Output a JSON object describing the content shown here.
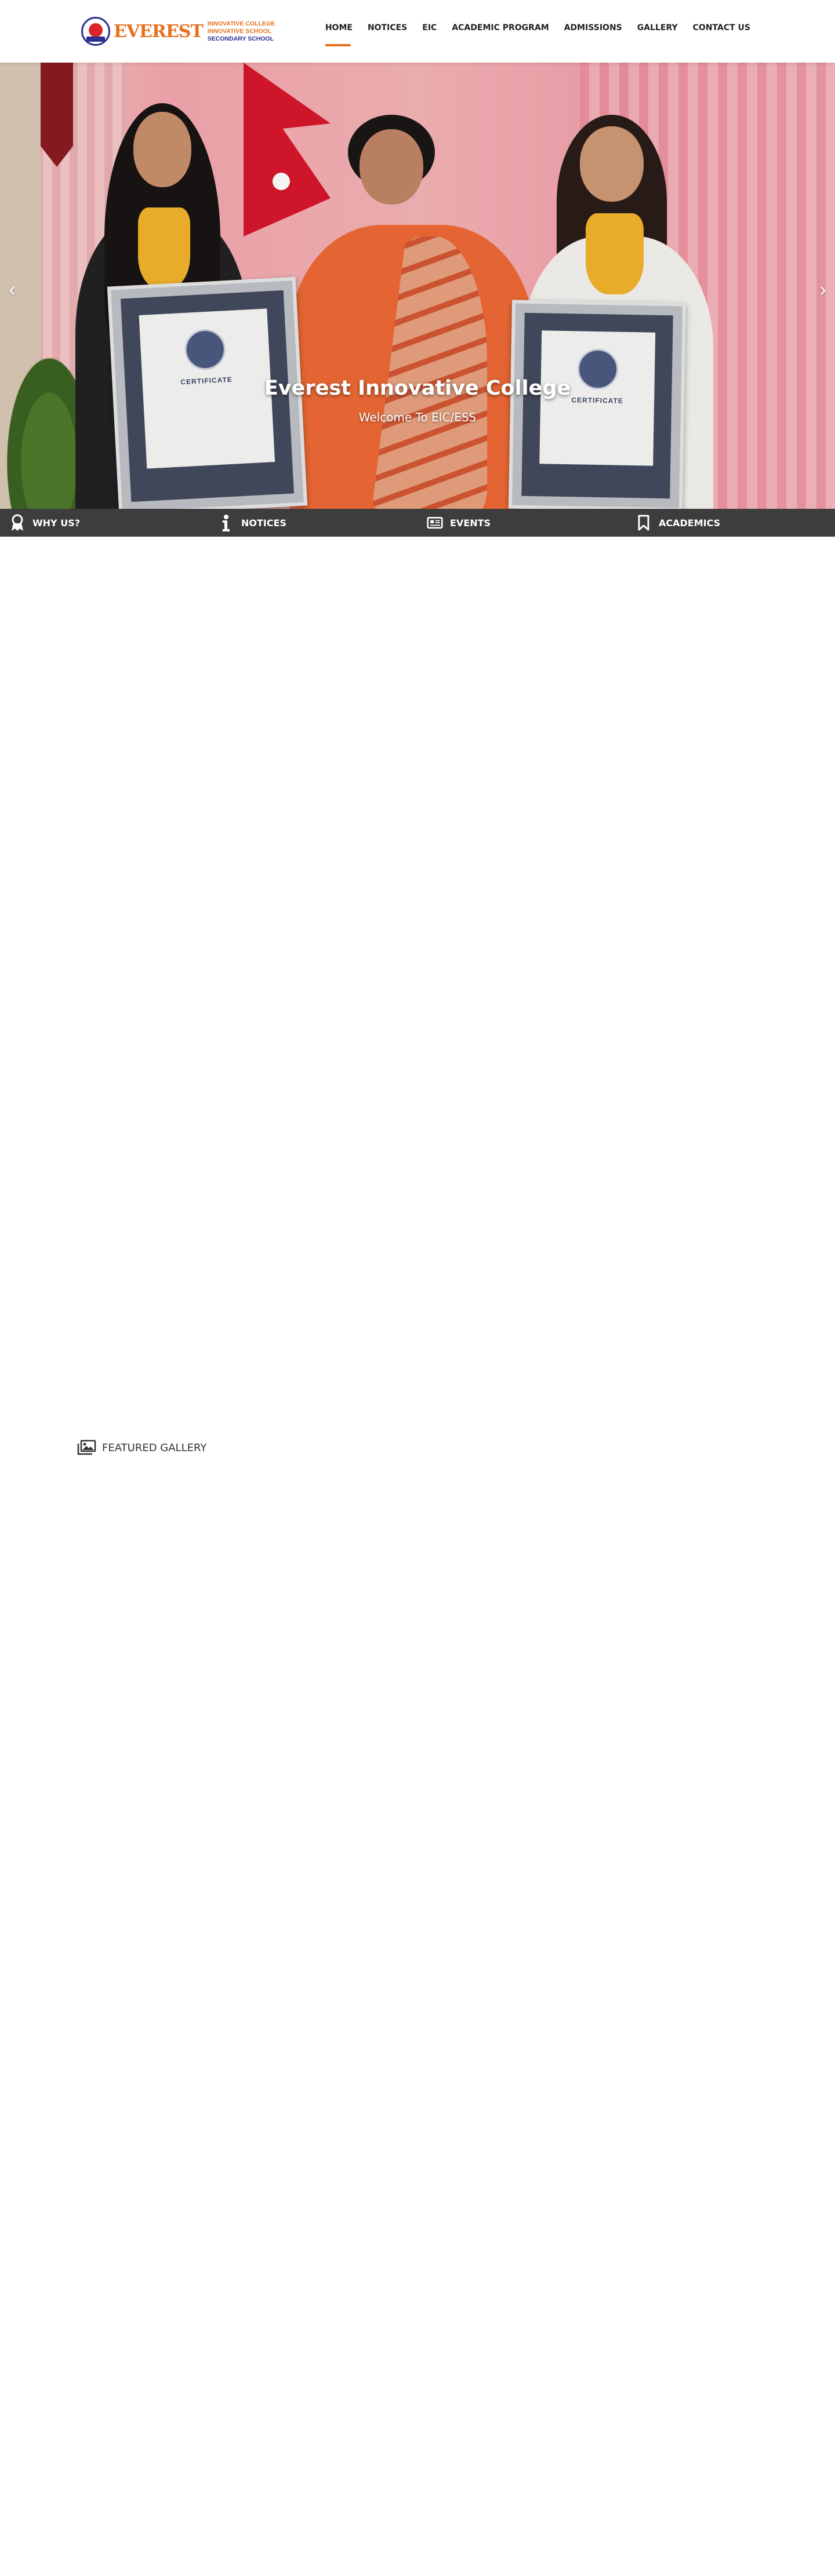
{
  "header": {
    "logo": {
      "wordmark": "EVEREST",
      "lines": [
        "INNOVATIVE COLLEGE",
        "INNOVATIVE SCHOOL",
        "SECONDARY SCHOOL"
      ]
    },
    "nav": [
      {
        "label": "HOME",
        "active": true
      },
      {
        "label": "NOTICES",
        "active": false
      },
      {
        "label": "EIC",
        "active": false
      },
      {
        "label": "ACADEMIC PROGRAM",
        "active": false
      },
      {
        "label": "ADMISSIONS",
        "active": false
      },
      {
        "label": "GALLERY",
        "active": false
      },
      {
        "label": "CONTACT US",
        "active": false
      }
    ]
  },
  "hero": {
    "title": "Everest Innovative College",
    "subtitle": "Welcome To EIC/ESS",
    "prev_icon": "chevron-left-icon",
    "next_icon": "chevron-right-icon",
    "certificate_label": "CERTIFICATE"
  },
  "quickbar": [
    {
      "label": "WHY US?",
      "icon": "award-icon"
    },
    {
      "label": "NOTICES",
      "icon": "info-icon"
    },
    {
      "label": "EVENTS",
      "icon": "newspaper-icon"
    },
    {
      "label": "ACADEMICS",
      "icon": "bookmark-icon"
    }
  ],
  "featured_gallery": {
    "label": "FEATURED GALLERY",
    "icon": "images-icon"
  },
  "colors": {
    "accent": "#e8701c",
    "quickbar_bg": "#3d3d3d",
    "brand_blue": "#2b2f8f"
  }
}
